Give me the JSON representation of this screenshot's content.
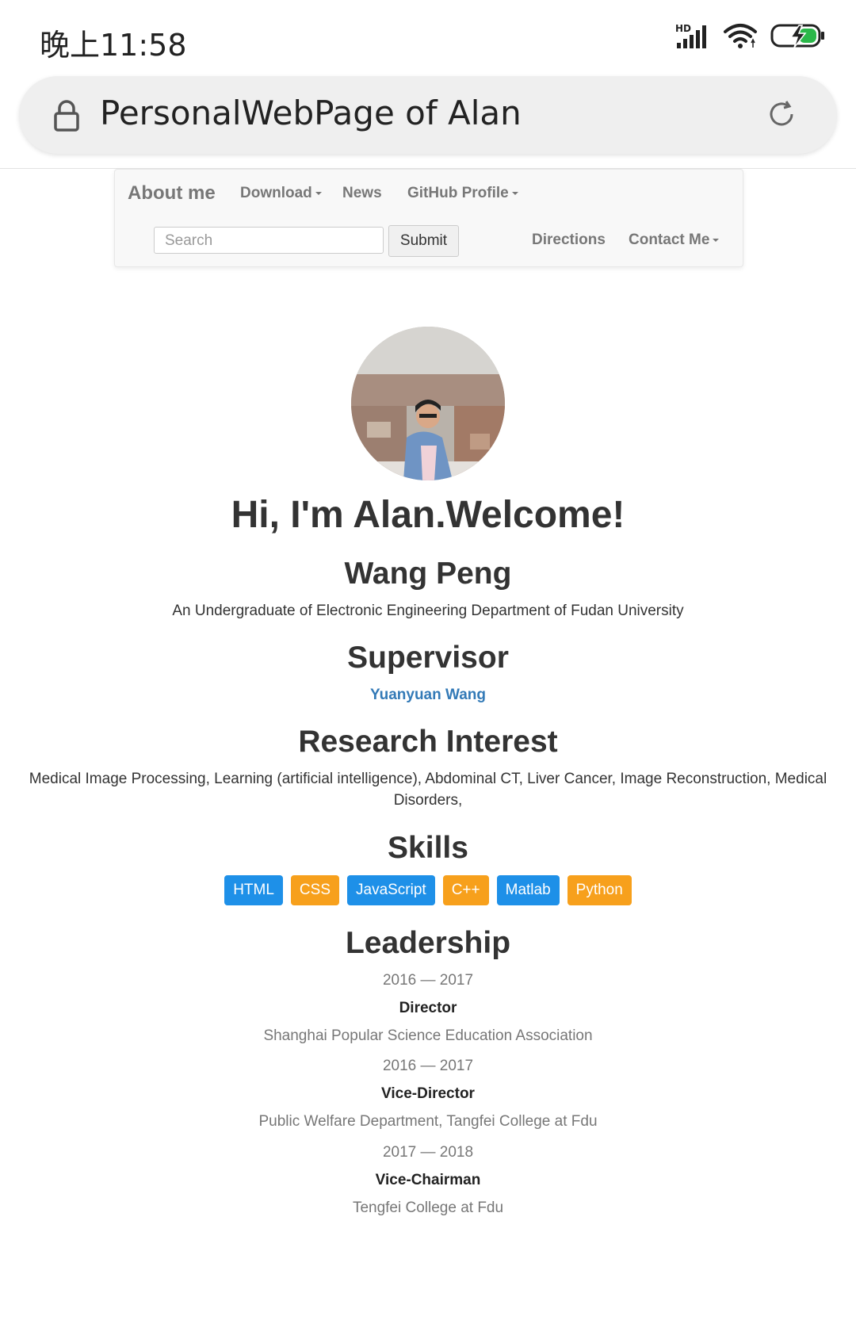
{
  "status_bar": {
    "time": "晚上11:58",
    "network_label": "HD",
    "icons": [
      "signal-icon",
      "wifi-icon",
      "battery-charging-icon"
    ]
  },
  "browser": {
    "page_title": "PersonalWebPage of Alan",
    "icons": [
      "lock-icon",
      "reload-icon"
    ]
  },
  "navbar": {
    "brand": "About me",
    "links": [
      "Download",
      "News",
      "GitHub Profile",
      "Directions",
      "Contact Me"
    ],
    "search_placeholder": "Search",
    "submit_label": "Submit"
  },
  "profile": {
    "greeting": "Hi, I'm Alan.Welcome!",
    "name": "Wang Peng",
    "subtitle": "An Undergraduate of Electronic Engineering Department of Fudan University"
  },
  "supervisor": {
    "heading": "Supervisor",
    "name": "Yuanyuan Wang"
  },
  "research": {
    "heading": "Research Interest",
    "line1": "Medical Image Processing, Learning (artificial intelligence), Abdominal CT, Liver Cancer, Image Reconstruction, Medical",
    "line2": "Disorders,"
  },
  "skills": {
    "heading": "Skills",
    "tags": [
      "HTML",
      "CSS",
      "JavaScript",
      "C++",
      "Matlab",
      "Python"
    ],
    "colors": {
      "blue": "#1e90e8",
      "orange": "#f7a01c"
    }
  },
  "leadership": {
    "heading": "Leadership",
    "entries": [
      {
        "years": "2016 — 2017",
        "role": "Director",
        "org": "Shanghai Popular Science Education Association"
      },
      {
        "years": "2016 — 2017",
        "role": "Vice-Director",
        "org": "Public Welfare Department, Tangfei College at Fdu"
      },
      {
        "years": "2017 — 2018",
        "role": "Vice-Chairman",
        "org": "Tengfei College at Fdu"
      }
    ]
  }
}
